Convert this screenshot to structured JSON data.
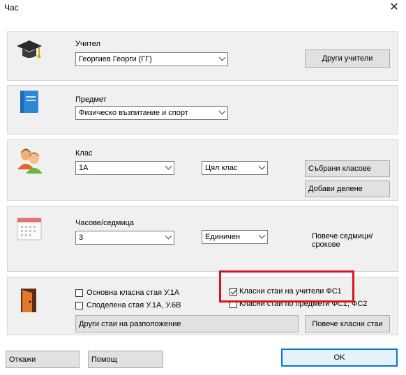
{
  "window": {
    "title": "Час",
    "close_glyph": "✕"
  },
  "teacher": {
    "label": "Учител",
    "value": "Георгиев Георги (ГГ)",
    "other_button": "Други учители",
    "icon": "graduation-cap-icon"
  },
  "subject": {
    "label": "Предмет",
    "value": "Физическо възпитание и спорт",
    "icon": "book-icon"
  },
  "class": {
    "label": "Клас",
    "value": "1А",
    "scope_value": "Цял клас",
    "merged_button": "Събрани класове",
    "add_split_button": "Добави делене",
    "icon": "students-icon"
  },
  "hours": {
    "label": "Часове/седмица",
    "value": "3",
    "mode_value": "Единичен",
    "more_label": "Повече седмици/срокове",
    "icon": "calendar-icon"
  },
  "rooms": {
    "icon": "door-icon",
    "main_room": "Основна класна стая У.1А",
    "shared_room": "Споделена стая У.1А, У.6В",
    "teacher_rooms": "Класни стаи на учители ФС1",
    "subject_rooms": "Класни стаи по предмети ФС1, ФС2",
    "other_rooms_button": "Други стаи на разположение",
    "more_rooms_button": "Повече класни стаи",
    "main_room_checked": false,
    "shared_room_checked": false,
    "teacher_rooms_checked": true,
    "subject_rooms_checked": false
  },
  "footer": {
    "cancel": "Откажи",
    "help": "Помощ",
    "ok": "OK"
  },
  "colors": {
    "highlight": "#d9141b",
    "ok_border": "#0078d7"
  }
}
